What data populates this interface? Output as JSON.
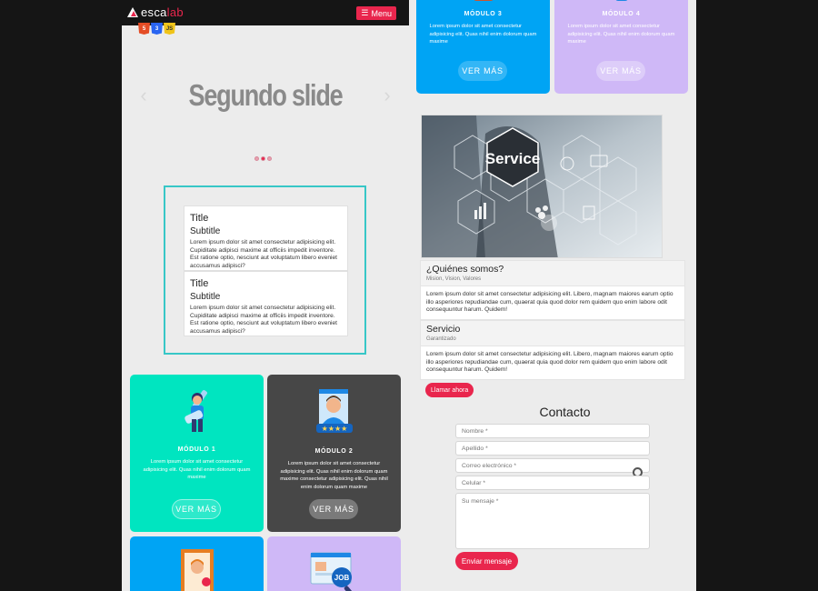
{
  "navbar": {
    "logo_prefix": "esca",
    "logo_highlight": "lab",
    "menu_label": "Menu",
    "badges": [
      "5",
      "3",
      "JS"
    ]
  },
  "carousel": {
    "slide_title": "Segundo slide",
    "dots": 3,
    "active_dot": 2
  },
  "cards": [
    {
      "title": "Title",
      "subtitle": "Subtitle",
      "text": "Lorem ipsum dolor sit amet consectetur adipisicing elit. Cupiditate adipisci maxime at officiis impedit inventore. Est ratione optio, nesciunt aut voluptatum libero eveniet accusamus adipisci?"
    },
    {
      "title": "Title",
      "subtitle": "Subtitle",
      "text": "Lorem ipsum dolor sit amet consectetur adipisicing elit. Cupiditate adipisci maxime at officiis impedit inventore. Est ratione optio, nesciunt aut voluptatum libero eveniet accusamus adipisci?"
    }
  ],
  "modules": {
    "m1": {
      "title": "MÓDULO 1",
      "text": "Lorem ipsum dolor sit amet consectetur adipisicing elit. Quas nihil enim dolorum quam maxime",
      "button": "VER MÁS"
    },
    "m2": {
      "title": "MÓDULO 2",
      "text": "Lorem ipsum dolor sit amet consectetur adipisicing elit. Quas nihil enim dolorum quam maxime consectetur adipisicing elit. Quas nihil enim dolorum quam maxime",
      "button": "VER MÁS"
    },
    "m3": {
      "title": "MÓDULO 3",
      "text": "Lorem ipsum dolor sit amet consectetur adipisicing elit. Quas nihil enim dolorum quam maxime",
      "button": "VER MÁS"
    },
    "m4": {
      "title": "MÓDULO 4",
      "text": "Lorem ipsum dolor sit amet consectetur adipisicing elit. Quas nihil enim dolorum quam maxime",
      "button": "VER MÁS"
    },
    "m6_label": "JOB"
  },
  "service_image": {
    "label": "Service"
  },
  "about": [
    {
      "heading": "¿Quiénes somos?",
      "subheading": "Mision, Vision, Valores",
      "text": "Lorem ipsum dolor sit amet consectetur adipisicing elit. Libero, magnam maiores earum optio illo asperiores repudiandae cum, quaerat quia quod dolor rem quidem quo enim labore odit consequuntur harum. Quidem!"
    },
    {
      "heading": "Servicio",
      "subheading": "Garantizado",
      "text": "Lorem ipsum dolor sit amet consectetur adipisicing elit. Libero, magnam maiores earum optio illo asperiores repudiandae cum, quaerat quia quod dolor rem quidem quo enim labore odit consequuntur harum. Quidem!"
    }
  ],
  "call_button": "Llamar ahora",
  "contact": {
    "title": "Contacto",
    "name_placeholder": "Nombre *",
    "surname_placeholder": "Apellido *",
    "email_placeholder": "Correo electrónico *",
    "phone_placeholder": "Celular *",
    "message_placeholder": "Su mensaje *",
    "send_button": "Enviar mensaje"
  },
  "colors": {
    "accent": "#e9264d",
    "teal": "#00e5c0",
    "dark": "#474747",
    "blue": "#00a4f4",
    "lavender": "#cfb8f7"
  }
}
